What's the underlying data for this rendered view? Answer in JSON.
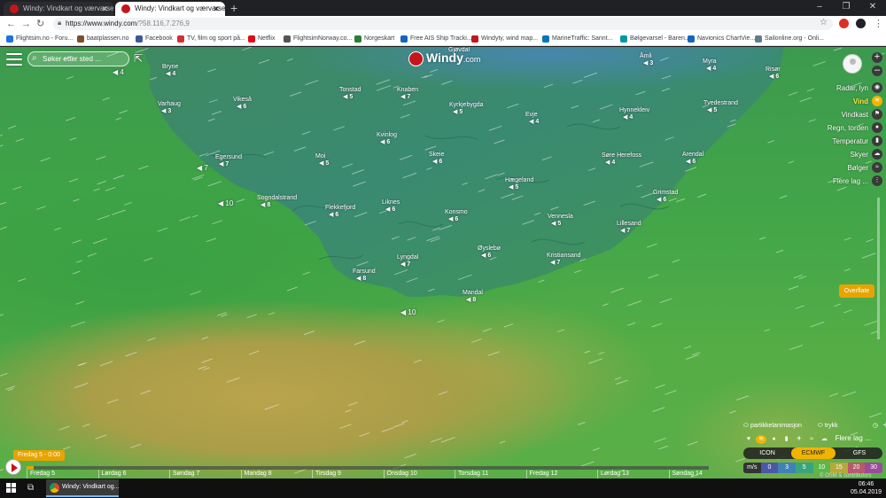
{
  "browser": {
    "tabs": [
      {
        "title": "Windy: Vindkart og værvarsel",
        "active": false
      },
      {
        "title": "Windy: Vindkart og værvarsel",
        "active": true
      }
    ],
    "url_main": "https://www.windy.com",
    "url_rest": "/?58.116,7.276,9",
    "bookmarks": [
      {
        "label": "Flightsim.no - Foru...",
        "color": "#1a73e8"
      },
      {
        "label": "baatplassen.no",
        "color": "#7b4f2a"
      },
      {
        "label": "Facebook",
        "color": "#3b5998"
      },
      {
        "label": "TV, film og sport på...",
        "color": "#d32f2f"
      },
      {
        "label": "Netflix",
        "color": "#e50914"
      },
      {
        "label": "FlightsimNorway.co...",
        "color": "#555555"
      },
      {
        "label": "Norgeskart",
        "color": "#2e7d32"
      },
      {
        "label": "Free AIS Ship Tracki...",
        "color": "#1565c0"
      },
      {
        "label": "Windyty, wind map...",
        "color": "#c4161c"
      },
      {
        "label": "MarineTraffic: Sannt...",
        "color": "#0277bd"
      },
      {
        "label": "Bølgevarsel - Baren...",
        "color": "#0097a7"
      },
      {
        "label": "Navionics ChartVie...",
        "color": "#1565c0"
      },
      {
        "label": "Sailonline.org - Onli...",
        "color": "#607d8b"
      }
    ]
  },
  "windy": {
    "search_placeholder": "Søker etter sted ...",
    "logo_text": "Windy",
    "logo_suffix": ".com",
    "layers": [
      {
        "label": "Radar, lyn",
        "icon": "radar-icon",
        "glyph": "◉",
        "active": false
      },
      {
        "label": "Vind",
        "icon": "wind-icon",
        "glyph": "≋",
        "active": true
      },
      {
        "label": "Vindkast",
        "icon": "flag-icon",
        "glyph": "⚑",
        "active": false
      },
      {
        "label": "Regn, torden",
        "icon": "rain-drop-icon",
        "glyph": "●",
        "active": false
      },
      {
        "label": "Temperatur",
        "icon": "thermometer-icon",
        "glyph": "▮",
        "active": false
      },
      {
        "label": "Skyer",
        "icon": "cloud-icon",
        "glyph": "☁",
        "active": false
      },
      {
        "label": "Bølger",
        "icon": "waves-icon",
        "glyph": "≈",
        "active": false
      },
      {
        "label": "Flere lag ...",
        "icon": "more-layers-icon",
        "glyph": "⋮",
        "active": false
      }
    ],
    "overflate_label": "Overflate",
    "particle_label": "partikkelanimasjon",
    "print_label": "trykk",
    "more_layers_bottom": "Flere lag ...",
    "models": [
      {
        "label": "ICON",
        "active": false
      },
      {
        "label": "ECMWF",
        "active": true
      },
      {
        "label": "GFS",
        "active": false
      }
    ],
    "legend_unit": "m/s",
    "legend_values": [
      "0",
      "3",
      "5",
      "10",
      "15",
      "20",
      "30"
    ],
    "legend_colors": [
      "#4c57a8",
      "#3f82b5",
      "#3aa57c",
      "#5db846",
      "#b4aa3c",
      "#b55a6a",
      "#9c4b9a"
    ],
    "attribution": "© OSM & contributors",
    "current_time": "Fredag 5 - 0:00",
    "timeline_progress": 0.01,
    "days": [
      "Fredag 5",
      "Lørdag 6",
      "Søndag 7",
      "Mandag 8",
      "Tirsdag 9",
      "Onsdag 10",
      "Torsdag 11",
      "Fredag 12",
      "Lørdag 13",
      "Søndag 14"
    ]
  },
  "map_labels": [
    {
      "name": "Bryne",
      "speed": "4"
    },
    {
      "name": "Varhaug",
      "speed": "3"
    },
    {
      "name": "Vikeså",
      "speed": "6"
    },
    {
      "name": "Tonstad",
      "speed": "5"
    },
    {
      "name": "Knaben",
      "speed": "7"
    },
    {
      "name": "Kyrkjebygda",
      "speed": "5"
    },
    {
      "name": "Evje",
      "speed": "4"
    },
    {
      "name": "Hynnekleiv",
      "speed": "4"
    },
    {
      "name": "Tvedestrand",
      "speed": "5"
    },
    {
      "name": "Egersund",
      "speed": "7"
    },
    {
      "name": "Moi",
      "speed": "5"
    },
    {
      "name": "Kvinlog",
      "speed": "6"
    },
    {
      "name": "Skeie",
      "speed": "6"
    },
    {
      "name": "Søre Herefoss",
      "speed": "4"
    },
    {
      "name": "Arendal",
      "speed": "6"
    },
    {
      "name": "Sogndalstrand",
      "speed": "8"
    },
    {
      "name": "Flekkefjord",
      "speed": "6"
    },
    {
      "name": "Liknes",
      "speed": "6"
    },
    {
      "name": "Hægeland",
      "speed": "5"
    },
    {
      "name": "Grimstad",
      "speed": "6"
    },
    {
      "name": "Konsmo",
      "speed": "6"
    },
    {
      "name": "Vennesla",
      "speed": "5"
    },
    {
      "name": "Lillesand",
      "speed": "7"
    },
    {
      "name": "Øyslebø",
      "speed": "6"
    },
    {
      "name": "Lyngdal",
      "speed": "7"
    },
    {
      "name": "Kristiansand",
      "speed": "7"
    },
    {
      "name": "Farsund",
      "speed": "8"
    },
    {
      "name": "Mandal",
      "speed": "8"
    },
    {
      "name": "Åmli",
      "speed": "3"
    },
    {
      "name": "Myra",
      "speed": "4"
    },
    {
      "name": "Risør",
      "speed": "6"
    },
    {
      "name": "Gjøvdal",
      "speed": ""
    }
  ],
  "sea_wind": [
    "4",
    "7",
    "10",
    "10",
    "5"
  ],
  "taskbar": {
    "app_label": "Windy: Vindkart og...",
    "time": "06:46",
    "date": "05.04.2019"
  }
}
